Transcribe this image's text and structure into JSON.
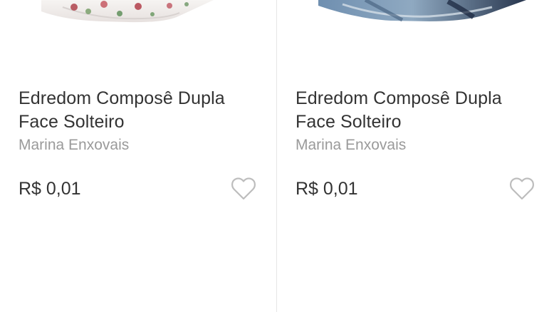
{
  "products": [
    {
      "title_line1": "Edredom Composê Dupla",
      "title_line2": "Face Solteiro",
      "seller": "Marina Enxovais",
      "price": "R$ 0,01",
      "image_theme": "floral-white",
      "favorite_icon": "heart-outline-icon"
    },
    {
      "title_line1": "Edredom Composê Dupla",
      "title_line2": "Face Solteiro",
      "seller": "Marina Enxovais",
      "price": "R$ 0,01",
      "image_theme": "blue-gray",
      "favorite_icon": "heart-outline-icon"
    }
  ],
  "colors": {
    "title": "#333333",
    "seller": "#9a9a9a",
    "price": "#333333",
    "heart_outline": "#bdbdbd",
    "divider": "#e6e6e6"
  }
}
